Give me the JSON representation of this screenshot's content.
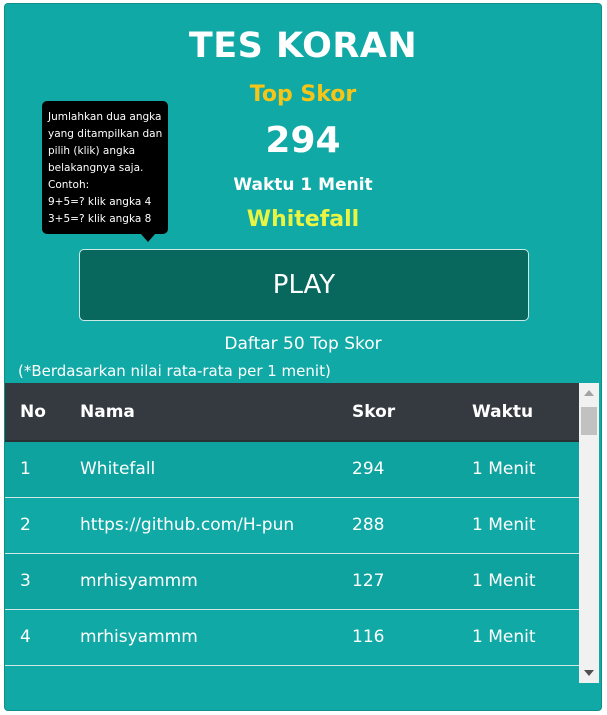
{
  "header": {
    "title": "TES KORAN",
    "top_skor_label": "Top Skor",
    "top_score": "294",
    "duration": "Waktu 1 Menit",
    "top_player": "Whitefall"
  },
  "tooltip": {
    "lines": [
      "Jumlahkan dua angka",
      "yang ditampilkan dan",
      "pilih (klik) angka",
      "belakangnya saja.",
      "Contoh:",
      "9+5=? klik angka 4",
      "3+5=? klik angka 8"
    ]
  },
  "play_button": {
    "label": "PLAY"
  },
  "leaderboard": {
    "title": "Daftar 50 Top Skor",
    "note": "(*Berdasarkan nilai rata-rata per 1 menit)",
    "columns": [
      "No",
      "Nama",
      "Skor",
      "Waktu"
    ],
    "rows": [
      [
        "1",
        "Whitefall",
        "294",
        "1 Menit"
      ],
      [
        "2",
        "https://github.com/H-pun",
        "288",
        "1 Menit"
      ],
      [
        "3",
        "mrhisyammm",
        "127",
        "1 Menit"
      ],
      [
        "4",
        "mrhisyammm",
        "116",
        "1 Menit"
      ]
    ]
  },
  "colors": {
    "card_bg": "#11a9a6",
    "top_skor_label": "#f5c518",
    "top_player": "#e9f542",
    "play_button_bg": "#08685e",
    "table_header_bg": "#343a40"
  }
}
